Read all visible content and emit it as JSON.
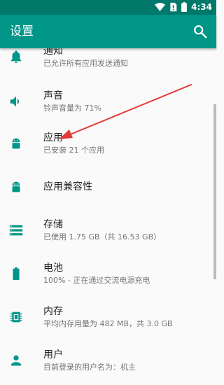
{
  "status_bar": {
    "time": "4:34",
    "icons": [
      "wifi-icon",
      "no-sim-icon",
      "battery-icon"
    ]
  },
  "app_bar": {
    "title": "设置",
    "action_icon": "search-icon"
  },
  "settings": [
    {
      "icon": "bell-icon",
      "title": "通知",
      "summary": "已允许所有应用发送通知"
    },
    {
      "icon": "volume-icon",
      "title": "声音",
      "summary": "铃声音量为 71%"
    },
    {
      "icon": "android-icon",
      "title": "应用",
      "summary": "已安装 21 个应用"
    },
    {
      "icon": "android-icon",
      "title": "应用兼容性",
      "summary": ""
    },
    {
      "icon": "storage-icon",
      "title": "存储",
      "summary": "已使用 1.75 GB（共 16.53 GB）"
    },
    {
      "icon": "battery-icon",
      "title": "电池",
      "summary": "100% - 正在通过交流电源充电"
    },
    {
      "icon": "memory-icon",
      "title": "内存",
      "summary": "平均内存用量为 482 MB，共 3.0 GB"
    },
    {
      "icon": "person-icon",
      "title": "用户",
      "summary": "目前登录的用户名为：机主"
    }
  ],
  "colors": {
    "status_bar": "#00796b",
    "app_bar": "#009688",
    "icon_teal": "#009688",
    "arrow_red": "#e53935"
  }
}
